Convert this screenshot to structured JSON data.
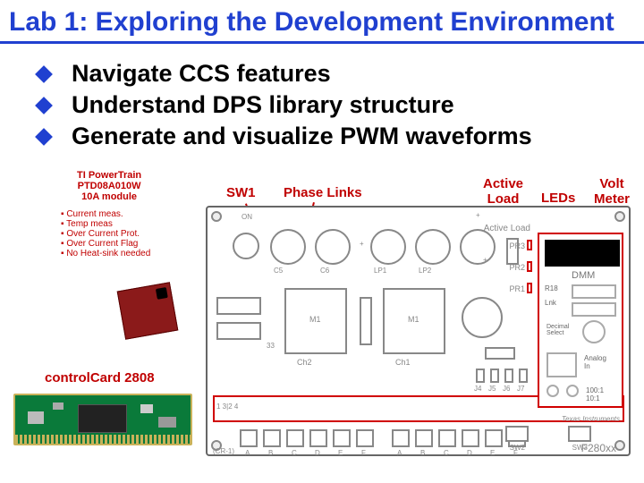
{
  "title": "Lab 1: Exploring the Development Environment",
  "bullets": [
    "Navigate CCS features",
    "Understand DPS library structure",
    "Generate and visualize PWM waveforms"
  ],
  "module_block": {
    "l1": "TI PowerTrain",
    "l2": "PTD08A010W",
    "l3": "10A module",
    "items": [
      "Current meas.",
      "Temp meas",
      "Over Current Prot.",
      "Over Current Flag",
      "No Heat-sink needed"
    ]
  },
  "labels": {
    "controlcard": "controlCard 2808",
    "sw1": "SW1",
    "phase": "Phase Links",
    "active": "Active\nLoad",
    "leds": "LEDs",
    "volt": "Volt\nMeter"
  },
  "pcb": {
    "dmm": "DMM",
    "activeload": "Active Load",
    "ti": "Texas Instruments",
    "board": "F280xx",
    "prs": [
      "PR3",
      "PR2",
      "PR1"
    ],
    "m": [
      "M1",
      "M1"
    ],
    "ch": [
      "Ch2",
      "Ch1"
    ],
    "j": [
      "J4",
      "J5",
      "J6",
      "J7"
    ],
    "bottom": [
      "A",
      "B",
      "C",
      "D",
      "E",
      "F",
      "A",
      "B",
      "C",
      "D",
      "E",
      "F"
    ],
    "cr": "(CR-1)",
    "pins": "1 3|2 4"
  }
}
